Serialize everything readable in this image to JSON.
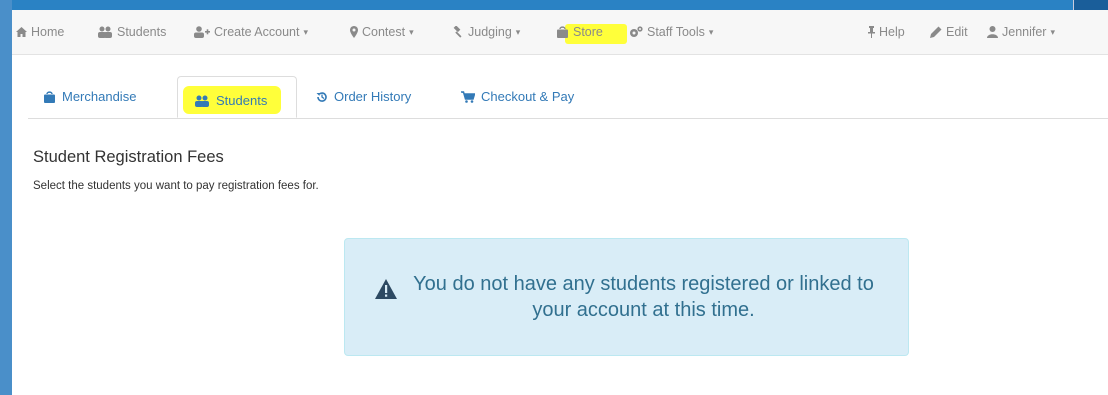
{
  "navbar": {
    "home": "Home",
    "students": "Students",
    "create_account": "Create Account",
    "contest": "Contest",
    "judging": "Judging",
    "store": "Store",
    "staff_tools": "Staff Tools",
    "help": "Help",
    "edit": "Edit",
    "user": "Jennifer",
    "caret": "▾"
  },
  "tabs": {
    "merchandise": "Merchandise",
    "students": "Students",
    "order_history": "Order History",
    "checkout": "Checkout & Pay"
  },
  "main": {
    "title": "Student Registration Fees",
    "subtitle": "Select the students you want to pay registration fees for.",
    "alert": "You do not have any students registered or linked to your account at this time."
  },
  "colors": {
    "accent": "#337ab7",
    "highlight": "#ffff3a",
    "alert_bg": "#d9edf7",
    "alert_text": "#31708f"
  },
  "icons": {
    "home": "home-icon",
    "students": "users-icon",
    "create_account": "user-plus-icon",
    "contest": "map-marker-icon",
    "judging": "gavel-icon",
    "store": "shopping-bag-icon",
    "staff_tools": "cogs-icon",
    "help": "pushpin-icon",
    "edit": "pencil-icon",
    "user": "user-icon",
    "order_history": "history-icon",
    "checkout": "cart-icon",
    "alert": "warning-icon"
  }
}
